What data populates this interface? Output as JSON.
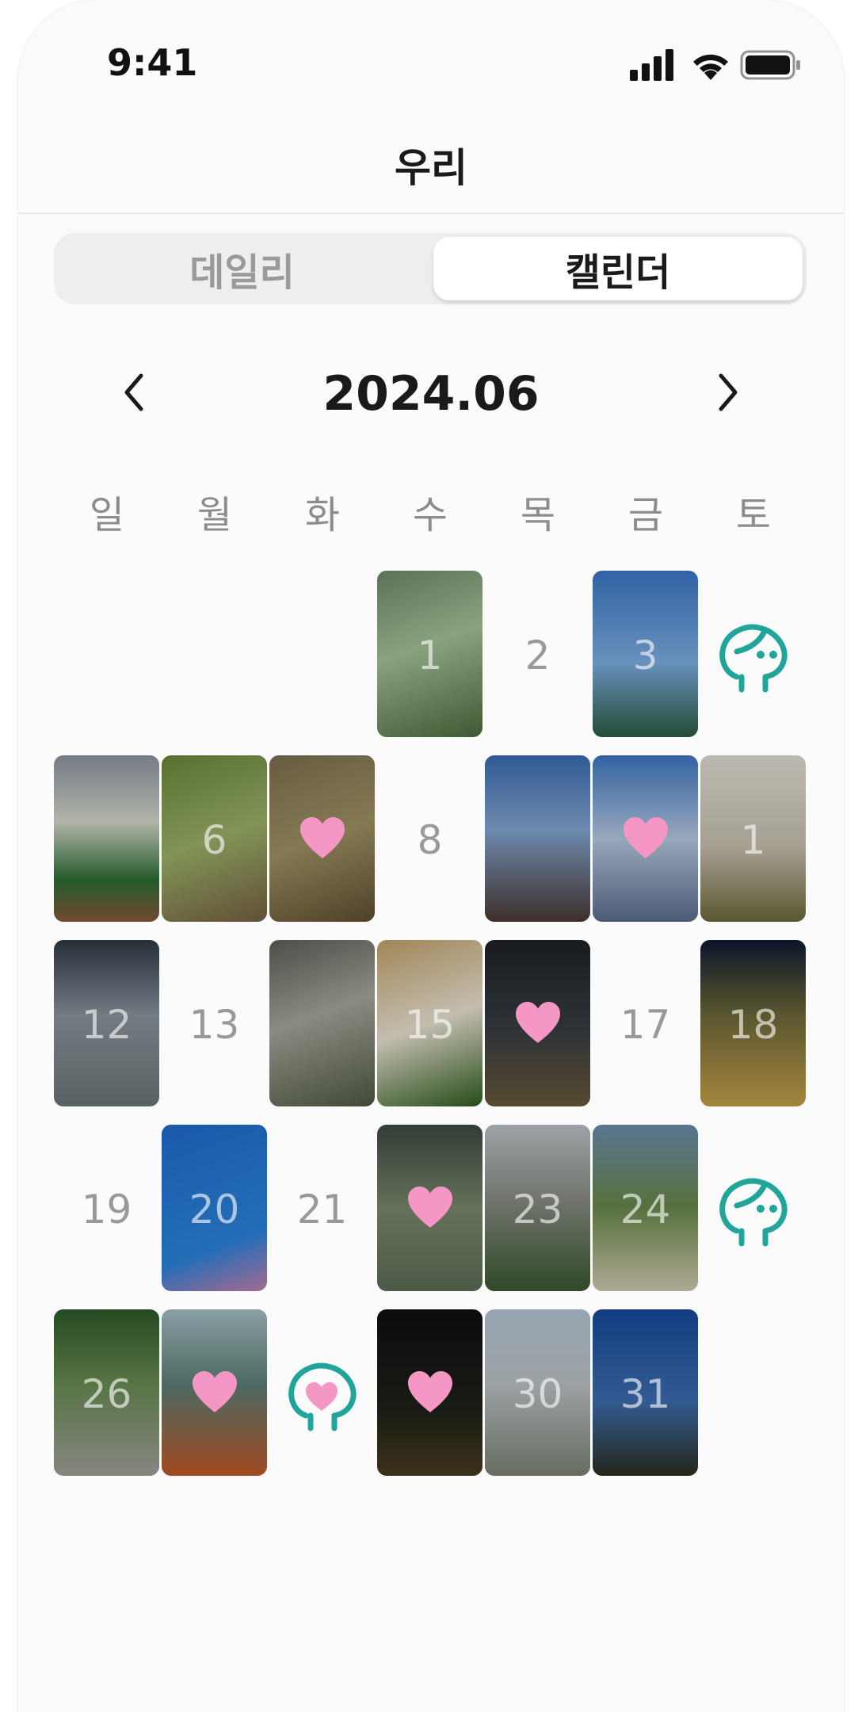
{
  "status_bar": {
    "time": "9:41"
  },
  "header": {
    "title": "우리"
  },
  "segmented": {
    "daily_label": "데일리",
    "calendar_label": "캘린더",
    "selected": "캘린더"
  },
  "calendar": {
    "month_label": "2024.06",
    "weekdays": [
      "일",
      "월",
      "화",
      "수",
      "목",
      "금",
      "토"
    ],
    "colors": {
      "accent_teal": "#21a59a",
      "heart_pink": "#f597c4",
      "day_number": "#999999"
    },
    "days": [
      {
        "day": "1",
        "type": "photo"
      },
      {
        "day": "2",
        "type": "empty"
      },
      {
        "day": "3",
        "type": "photo"
      },
      {
        "day": "",
        "type": "character"
      },
      {
        "day": "",
        "type": "photo"
      },
      {
        "day": "6",
        "type": "photo"
      },
      {
        "day": "",
        "type": "photo-heart"
      },
      {
        "day": "8",
        "type": "empty"
      },
      {
        "day": "",
        "type": "photo"
      },
      {
        "day": "",
        "type": "photo-heart"
      },
      {
        "day": "1",
        "type": "photo"
      },
      {
        "day": "12",
        "type": "photo"
      },
      {
        "day": "13",
        "type": "empty"
      },
      {
        "day": "",
        "type": "photo"
      },
      {
        "day": "15",
        "type": "photo"
      },
      {
        "day": "",
        "type": "photo-heart"
      },
      {
        "day": "17",
        "type": "empty"
      },
      {
        "day": "18",
        "type": "photo"
      },
      {
        "day": "19",
        "type": "empty"
      },
      {
        "day": "20",
        "type": "photo"
      },
      {
        "day": "21",
        "type": "empty"
      },
      {
        "day": "",
        "type": "photo-heart"
      },
      {
        "day": "23",
        "type": "photo"
      },
      {
        "day": "24",
        "type": "photo"
      },
      {
        "day": "",
        "type": "character"
      },
      {
        "day": "26",
        "type": "photo"
      },
      {
        "day": "",
        "type": "photo-heart"
      },
      {
        "day": "",
        "type": "character-heart"
      },
      {
        "day": "",
        "type": "photo-heart"
      },
      {
        "day": "30",
        "type": "photo"
      },
      {
        "day": "31",
        "type": "photo"
      }
    ]
  }
}
